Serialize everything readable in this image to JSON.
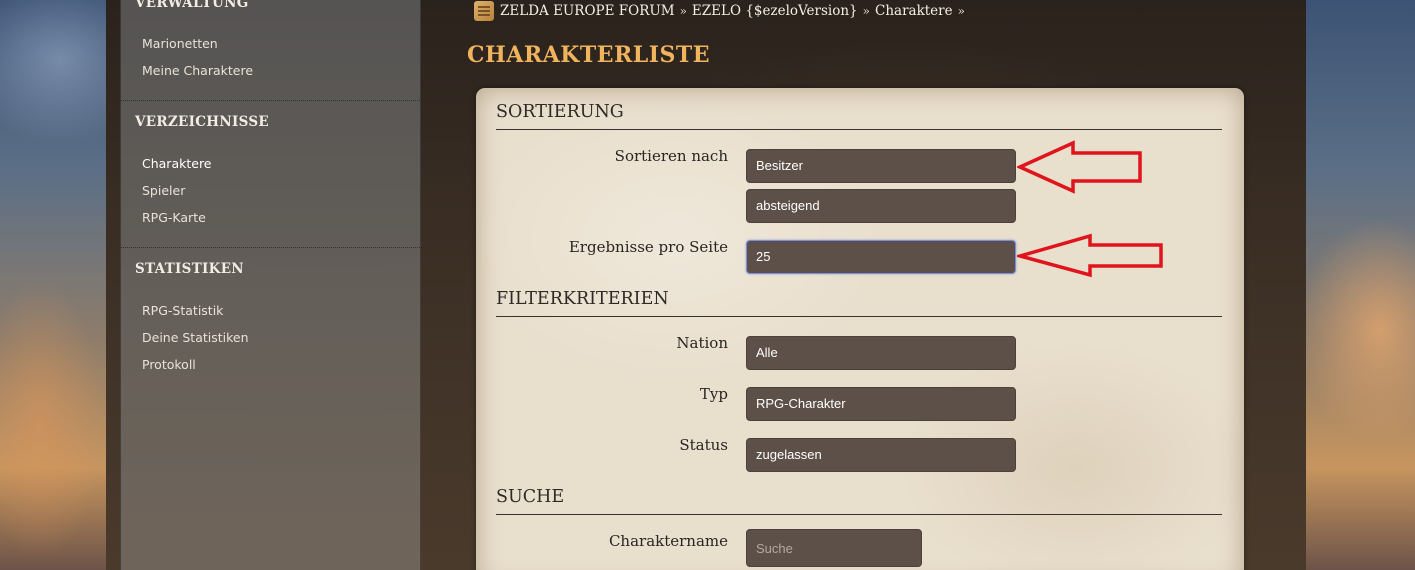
{
  "sidebar": {
    "sections": [
      {
        "heading": "VERWALTUNG",
        "items": [
          "Marionetten",
          "Meine Charaktere"
        ]
      },
      {
        "heading": "VERZEICHNISSE",
        "items": [
          "Charaktere",
          "Spieler",
          "RPG-Karte"
        ]
      },
      {
        "heading": "STATISTIKEN",
        "items": [
          "RPG-Statistik",
          "Deine Statistiken",
          "Protokoll"
        ]
      }
    ]
  },
  "breadcrumb": {
    "items": [
      "ZELDA EUROPE FORUM",
      "EZELO {$ezeloVersion}",
      "Charaktere"
    ],
    "separator": "»"
  },
  "page": {
    "title": "CHARAKTERLISTE"
  },
  "sortierung": {
    "heading": "SORTIERUNG",
    "sort_by_label": "Sortieren nach",
    "sort_by_value": "Besitzer",
    "sort_order_value": "absteigend",
    "per_page_label": "Ergebnisse pro Seite",
    "per_page_value": "25"
  },
  "filter": {
    "heading": "FILTERKRITERIEN",
    "nation_label": "Nation",
    "nation_value": "Alle",
    "typ_label": "Typ",
    "typ_value": "RPG-Charakter",
    "status_label": "Status",
    "status_value": "zugelassen"
  },
  "suche": {
    "heading": "SUCHE",
    "name_label": "Charaktername",
    "name_placeholder": "Suche"
  },
  "colors": {
    "title_accent": "#f0b45e",
    "field_bg": "#5d5048",
    "parchment": "#e9dfcd",
    "annotation_arrow": "#e0141c"
  },
  "icons": {
    "breadcrumb_icon": "scroll-map-icon"
  }
}
